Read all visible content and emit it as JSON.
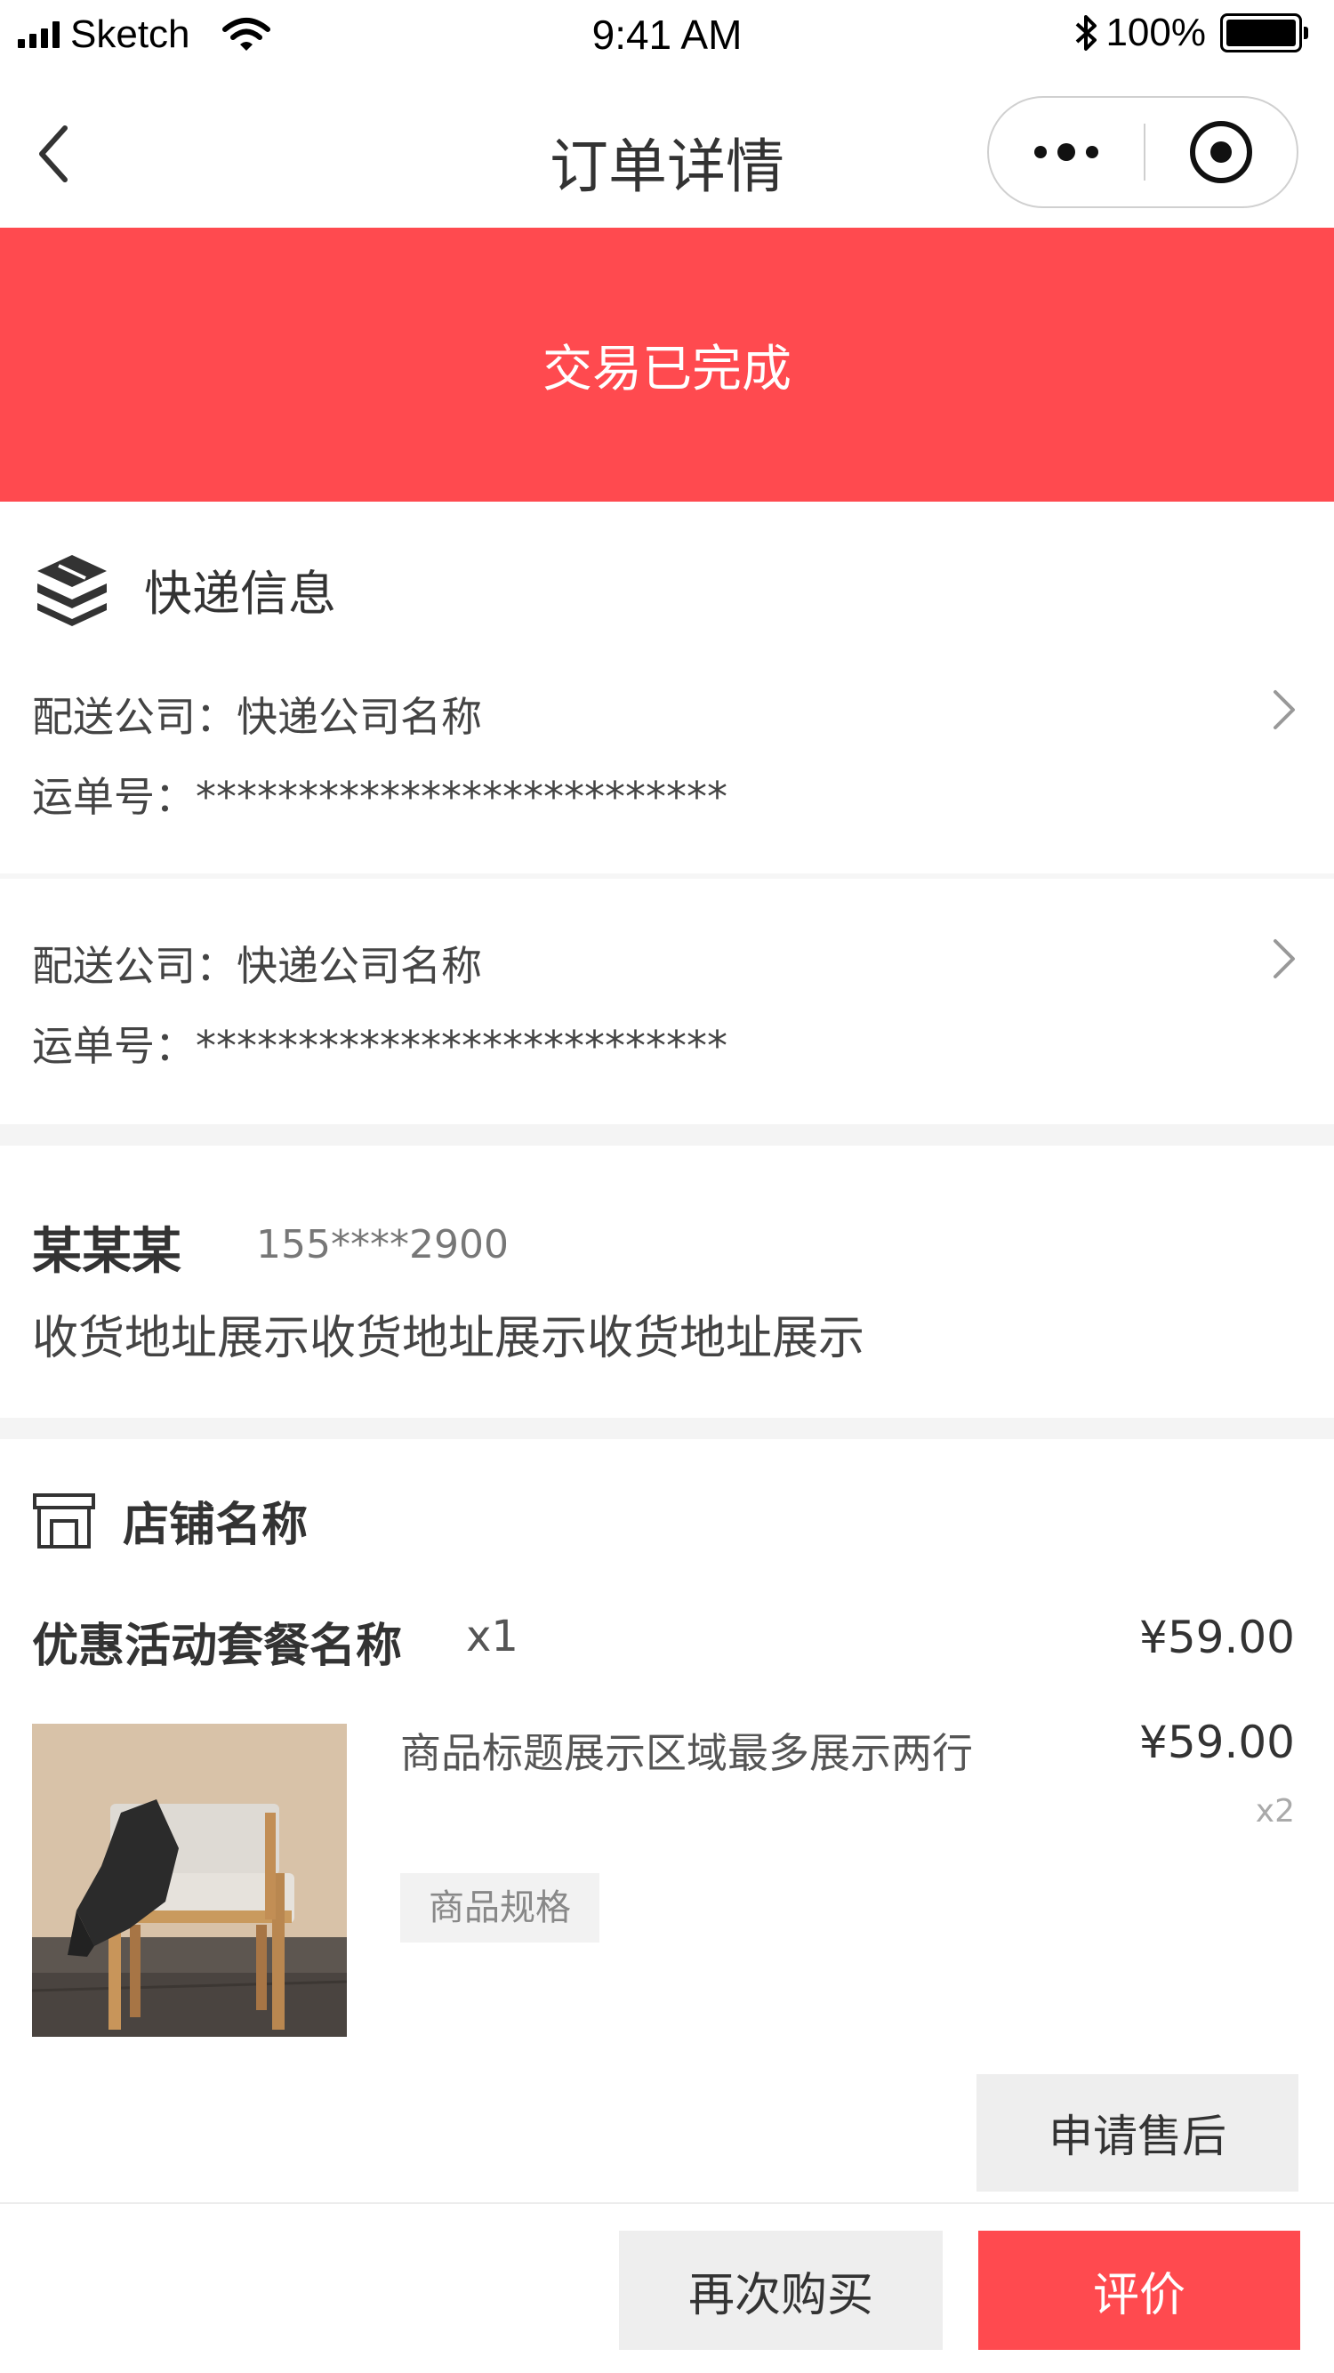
{
  "status_bar": {
    "carrier": "Sketch",
    "time": "9:41 AM",
    "battery": "100%"
  },
  "nav": {
    "title": "订单详情"
  },
  "banner": {
    "status": "交易已完成",
    "color": "#ff4a4f"
  },
  "logistics": {
    "title": "快递信息",
    "items": [
      {
        "company": "配送公司：快递公司名称",
        "tracking": "运单号：**************************"
      },
      {
        "company": "配送公司：快递公司名称",
        "tracking": "运单号：**************************"
      }
    ]
  },
  "recipient": {
    "name": "某某某",
    "phone": "155****2900",
    "address": "收货地址展示收货地址展示收货地址展示"
  },
  "shop": {
    "name": "店铺名称",
    "combo": {
      "name": "优惠活动套餐名称",
      "quantity": "x1",
      "price": "¥59.00"
    },
    "product": {
      "title": "商品标题展示区域最多展示两行",
      "spec": "商品规格",
      "price": "¥59.00",
      "quantity": "x2"
    },
    "aftersale_label": "申请售后"
  },
  "bottom": {
    "rebuy_label": "再次购买",
    "review_label": "评价"
  },
  "icons": {
    "back": "chevron-left-icon",
    "logistics": "boxes-icon",
    "shop": "shop-icon",
    "detail": "chevron-right-icon"
  }
}
